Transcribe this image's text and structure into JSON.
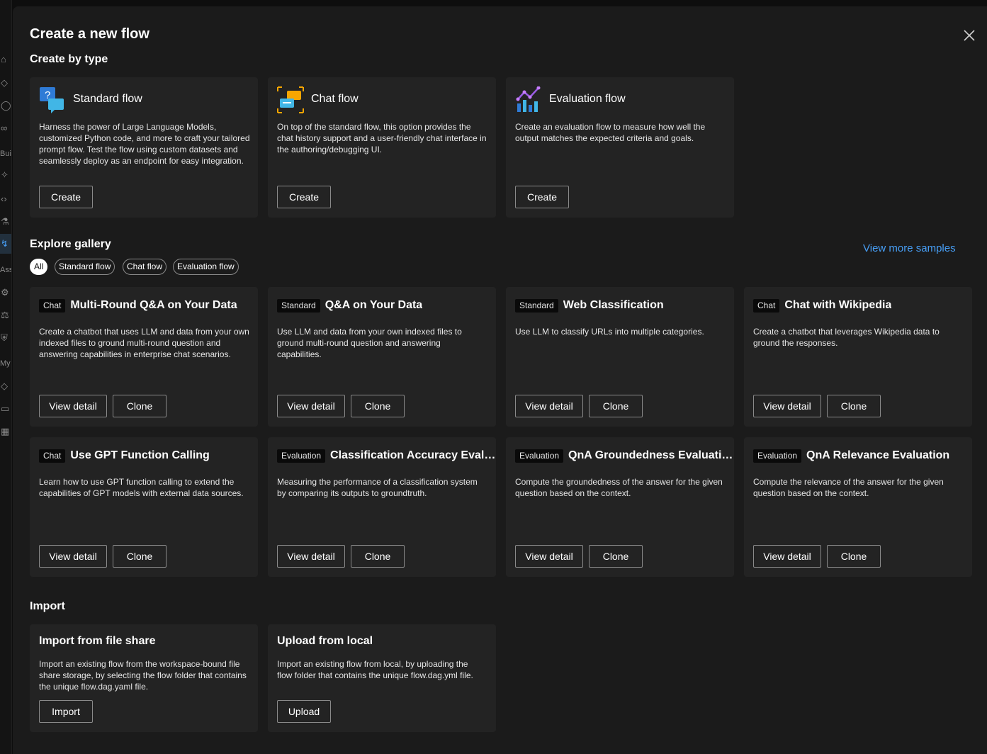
{
  "background_sidebar": {
    "labels": [
      "Bui",
      "Ass",
      "My"
    ]
  },
  "modal": {
    "title": "Create a new flow",
    "close_icon": "close-icon"
  },
  "create_by_type": {
    "heading": "Create by type",
    "cards": [
      {
        "title": "Standard flow",
        "icon": "standard-flow-icon",
        "description": "Harness the power of Large Language Models, customized Python code, and more to craft your tailored prompt flow. Test the flow using custom datasets and seamlessly deploy as an endpoint for easy integration.",
        "button": "Create"
      },
      {
        "title": "Chat flow",
        "icon": "chat-flow-icon",
        "description": "On top of the standard flow, this option provides the chat history support and a user-friendly chat interface in the authoring/debugging UI.",
        "button": "Create"
      },
      {
        "title": "Evaluation flow",
        "icon": "evaluation-flow-icon",
        "description": "Create an evaluation flow to measure how well the output matches the expected criteria and goals.",
        "button": "Create"
      }
    ]
  },
  "gallery": {
    "heading": "Explore gallery",
    "view_more": "View more samples",
    "filters": [
      "All",
      "Standard flow",
      "Chat flow",
      "Evaluation flow"
    ],
    "active_filter": "All",
    "view_label": "View detail",
    "clone_label": "Clone",
    "items": [
      {
        "tag": "Chat",
        "title": "Multi-Round Q&A on Your Data",
        "description": "Create a chatbot that uses LLM and data from your own indexed files to ground multi-round question and answering capabilities in enterprise chat scenarios."
      },
      {
        "tag": "Standard",
        "title": "Q&A on Your Data",
        "description": "Use LLM and data from your own indexed files to ground multi-round question and answering capabilities."
      },
      {
        "tag": "Standard",
        "title": "Web Classification",
        "description": "Use LLM to classify URLs into multiple categories."
      },
      {
        "tag": "Chat",
        "title": "Chat with Wikipedia",
        "description": "Create a chatbot that leverages Wikipedia data to ground the responses."
      },
      {
        "tag": "Chat",
        "title": "Use GPT Function Calling",
        "description": "Learn how to use GPT function calling to extend the capabilities of GPT models with external data sources."
      },
      {
        "tag": "Evaluation",
        "title": "Classification Accuracy Evalu...",
        "description": "Measuring the performance of a classification system by comparing its outputs to groundtruth."
      },
      {
        "tag": "Evaluation",
        "title": "QnA Groundedness Evaluation",
        "description": "Compute the groundedness of the answer for the given question based on the context."
      },
      {
        "tag": "Evaluation",
        "title": "QnA Relevance Evaluation",
        "description": "Compute the relevance of the answer for the given question based on the context."
      }
    ]
  },
  "import": {
    "heading": "Import",
    "cards": [
      {
        "title": "Import from file share",
        "description": "Import an existing flow from the workspace-bound file share storage, by selecting the flow folder that contains the unique flow.dag.yaml file.",
        "button": "Import"
      },
      {
        "title": "Upload from local",
        "description": "Import an existing flow from local, by uploading the flow folder that contains the unique flow.dag.yml file.",
        "button": "Upload"
      }
    ]
  },
  "colors": {
    "modal_bg": "#1b1b1b",
    "card_bg": "#232323",
    "link": "#479ef5"
  }
}
